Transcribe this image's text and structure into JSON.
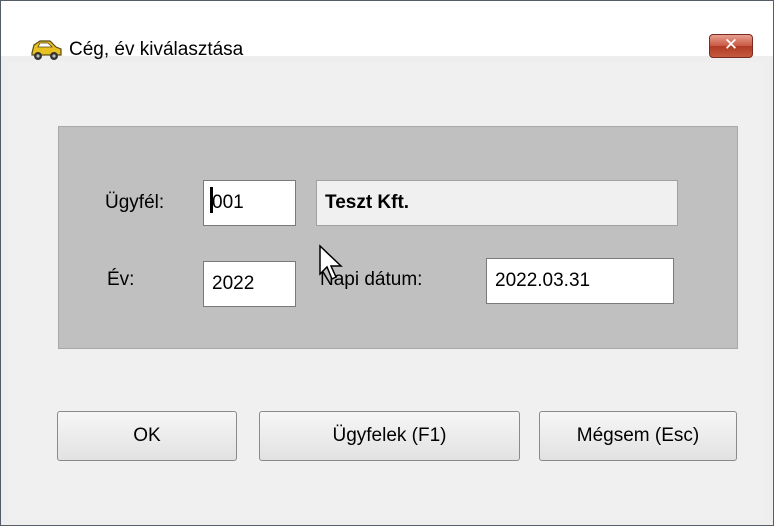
{
  "window": {
    "title": "Cég, év kiválasztása",
    "close_label": "✕",
    "app_icon": "car-icon"
  },
  "form": {
    "client_label": "Ügyfél:",
    "client_code": "001",
    "client_name": "Teszt Kft.",
    "year_label": "Év:",
    "year_value": "2022",
    "date_label": "Napi dátum:",
    "date_value": "2022.03.31"
  },
  "buttons": {
    "ok": "OK",
    "clients": "Ügyfelek (F1)",
    "cancel": "Mégsem (Esc)"
  },
  "colors": {
    "panel": "#c0c0c0",
    "close_button": "#c75843"
  }
}
